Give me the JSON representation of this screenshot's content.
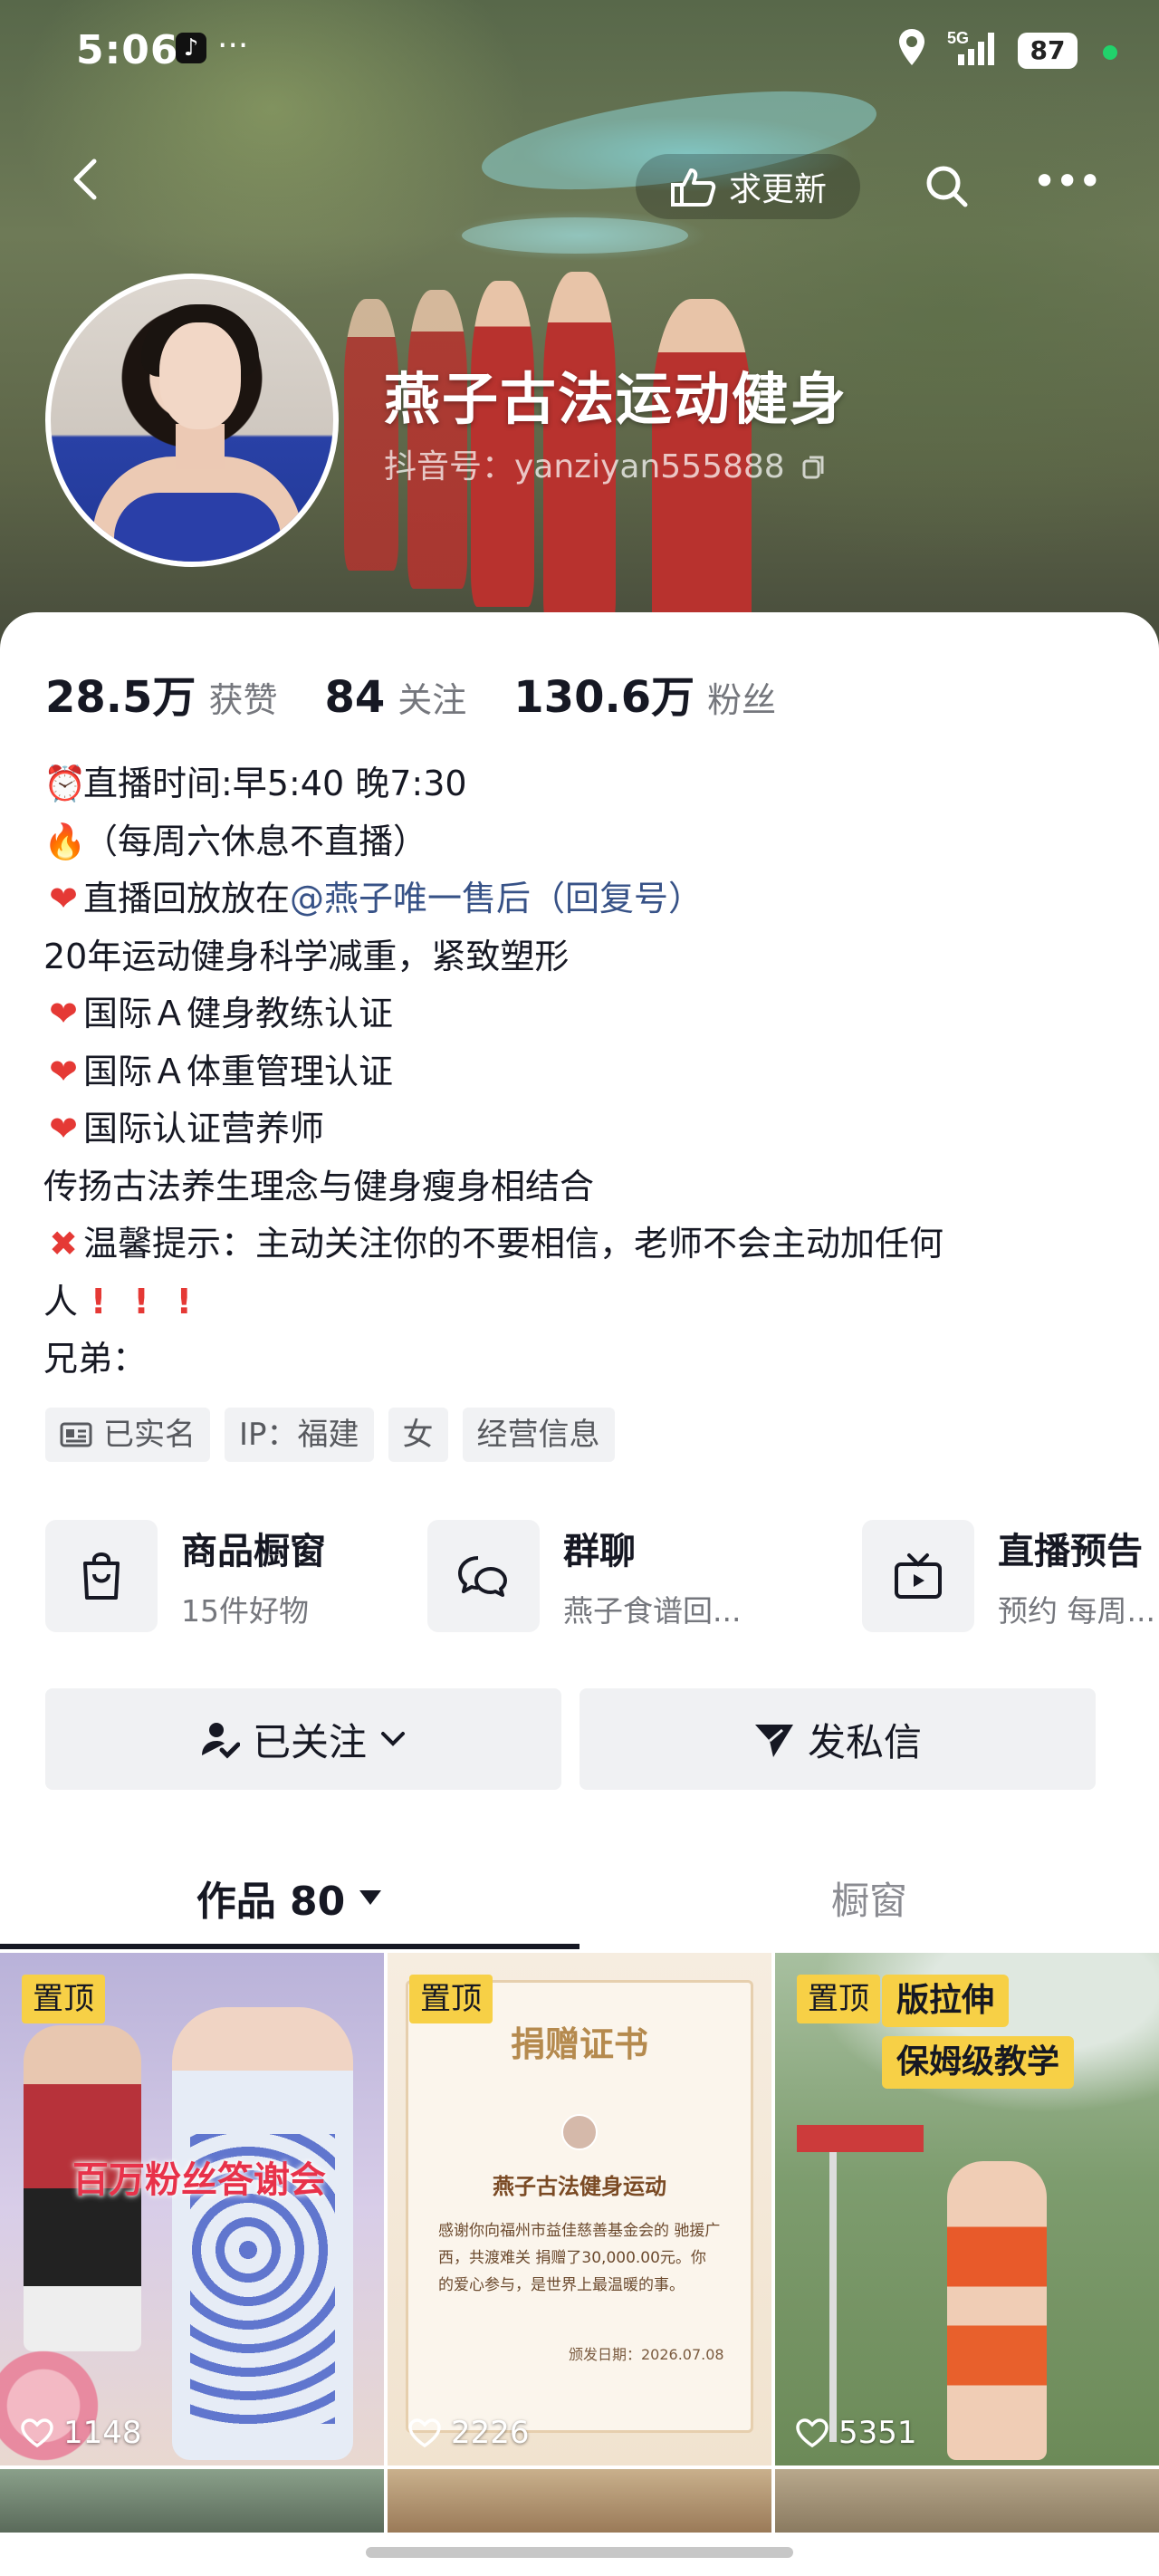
{
  "status_bar": {
    "time": "5:06",
    "network": "5G",
    "battery": "87"
  },
  "header": {
    "update_label": "求更新"
  },
  "profile": {
    "name": "燕子古法运动健身",
    "douyin_id": "抖音号：yanziyan555888"
  },
  "stats": [
    {
      "value": "28.5万",
      "label": "获赞"
    },
    {
      "value": "84",
      "label": "关注"
    },
    {
      "value": "130.6万",
      "label": "粉丝"
    }
  ],
  "bio": {
    "l1": "直播时间:早5:40 晚7:30",
    "l2": "（每周六休息不直播）",
    "l3_prefix": "直播回放放在",
    "l3_mention": "@燕子唯一售后（回复号）",
    "l4": "20年运动健身科学减重，紧致塑形",
    "l5": "国际Ａ健身教练认证",
    "l6": "国际Ａ体重管理认证",
    "l7": "国际认证营养师",
    "l8": "传扬古法养生理念与健身瘦身相结合",
    "l9": "温馨提示：主动关注你的不要相信，老师不会主动加任何",
    "l10": "人",
    "l11": "兄弟："
  },
  "tags": [
    "已实名",
    "IP：福建",
    "女",
    "经营信息"
  ],
  "services": [
    {
      "title": "商品橱窗",
      "sub": "15件好物"
    },
    {
      "title": "群聊",
      "sub": "燕子食谱回..."
    },
    {
      "title": "直播预告",
      "sub": "预约 每周..."
    }
  ],
  "actions": {
    "followed": "已关注",
    "message": "发私信"
  },
  "tabs": {
    "works": "作品 80",
    "shop": "橱窗"
  },
  "videos": [
    {
      "pin": "置顶",
      "overlay": "百万粉丝答谢会",
      "likes": "1148"
    },
    {
      "pin": "置顶",
      "cert_title": "捐赠证书",
      "cert_org": "燕子古法健身运动",
      "cert_body": "感谢你向福州市益佳慈善基金会的 驰援广西，共渡难关 捐赠了30,000.00元。你的爱心参与，是世界上最温暖的事。",
      "cert_date": "颁发日期：2026.07.08",
      "likes": "2226"
    },
    {
      "pin": "置顶",
      "overlay1": "版拉伸",
      "overlay2": "保姆级教学",
      "likes": "5351"
    }
  ]
}
